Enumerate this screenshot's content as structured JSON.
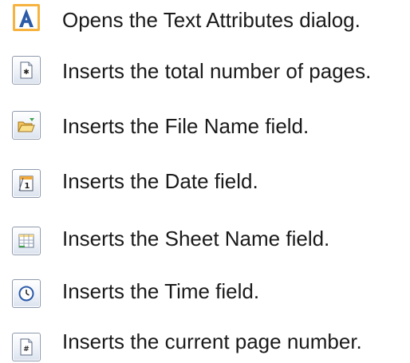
{
  "items": [
    {
      "label": "Opens the Text Attributes dialog.",
      "icon": "text-attributes-icon"
    },
    {
      "label": "Inserts the total number of pages.",
      "icon": "page-count-icon"
    },
    {
      "label": "Inserts the File Name field.",
      "icon": "file-name-icon"
    },
    {
      "label": "Inserts the Date field.",
      "icon": "date-icon"
    },
    {
      "label": "Inserts the Sheet Name field.",
      "icon": "sheet-name-icon"
    },
    {
      "label": "Inserts the Time field.",
      "icon": "time-icon"
    },
    {
      "label": "Inserts the current page number.",
      "icon": "page-number-icon"
    }
  ],
  "colors": {
    "text": "#1a1a1a",
    "button_border": "#8e9aad",
    "accent_blue": "#2b5aa8",
    "accent_orange": "#f0a93a",
    "accent_green": "#3fa34d"
  }
}
